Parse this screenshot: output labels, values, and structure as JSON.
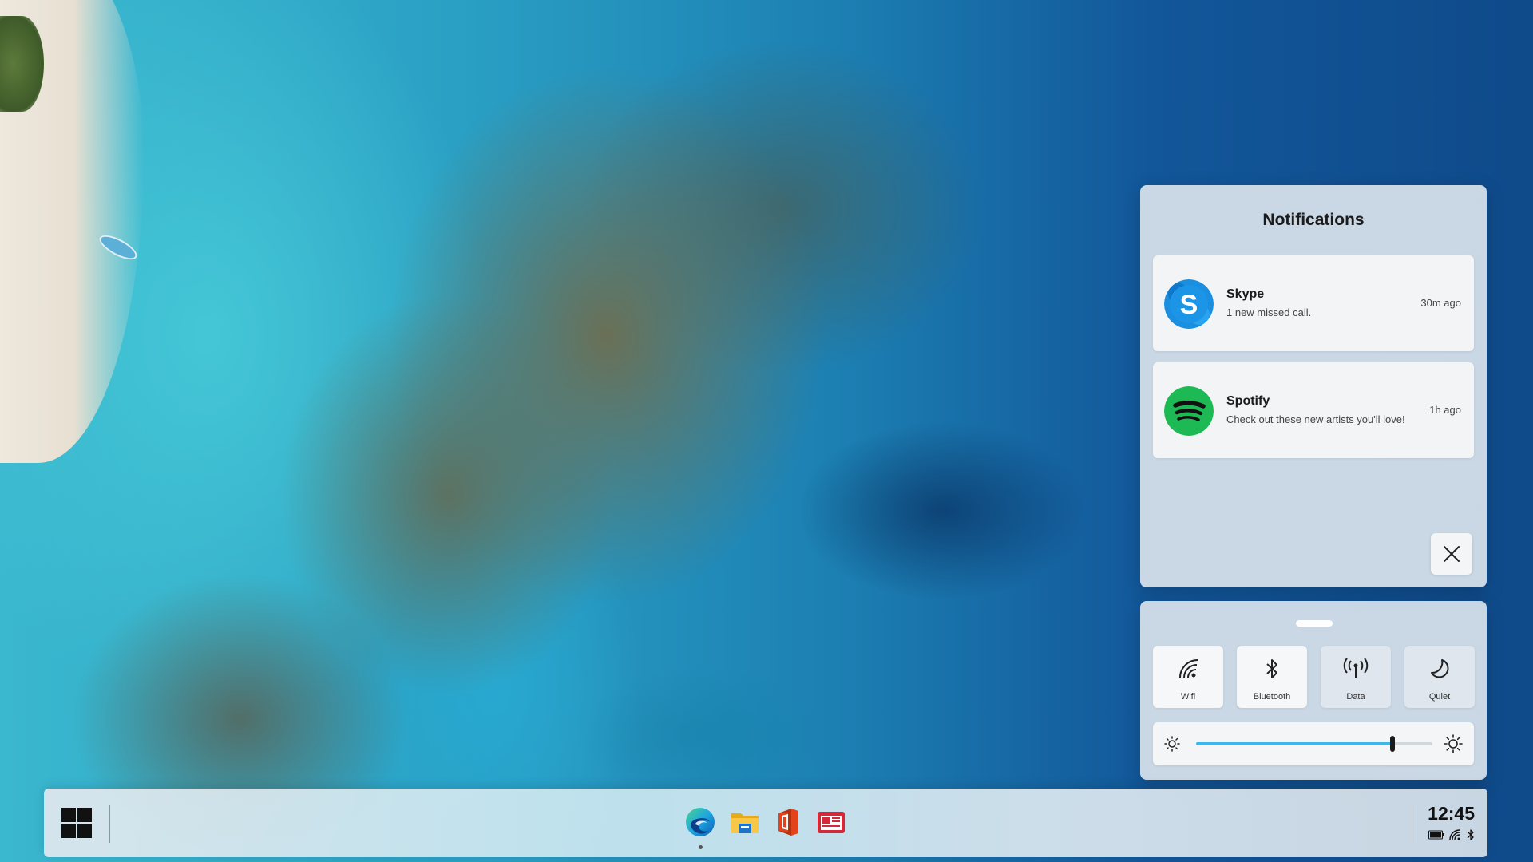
{
  "notifications": {
    "title": "Notifications",
    "items": [
      {
        "app": "Skype",
        "message": "1 new missed call.",
        "time": "30m ago",
        "icon": "skype-icon"
      },
      {
        "app": "Spotify",
        "message": "Check out these new artists you'll love!",
        "time": "1h ago",
        "icon": "spotify-icon"
      }
    ],
    "dismiss_icon": "close-icon"
  },
  "quick_settings": {
    "tiles": [
      {
        "label": "Wifi",
        "icon": "wifi-icon",
        "active": true
      },
      {
        "label": "Bluetooth",
        "icon": "bluetooth-icon",
        "active": true
      },
      {
        "label": "Data",
        "icon": "cellular-data-icon",
        "active": false
      },
      {
        "label": "Quiet",
        "icon": "moon-icon",
        "active": false
      }
    ],
    "brightness": 0.83
  },
  "taskbar": {
    "start_icon": "windows-logo-icon",
    "apps": [
      {
        "name": "edge",
        "icon": "edge-icon",
        "running": true
      },
      {
        "name": "file-explorer",
        "icon": "folder-icon",
        "running": false
      },
      {
        "name": "office",
        "icon": "office-icon",
        "running": false
      },
      {
        "name": "news",
        "icon": "news-icon",
        "running": false
      }
    ],
    "clock": "12:45",
    "tray_icons": [
      "battery-icon",
      "wifi-icon",
      "bluetooth-icon"
    ]
  },
  "colors": {
    "accent": "#3db6e9",
    "skype": "#1a8fe0",
    "spotify": "#1db954",
    "panel": "#d6e0ea"
  }
}
